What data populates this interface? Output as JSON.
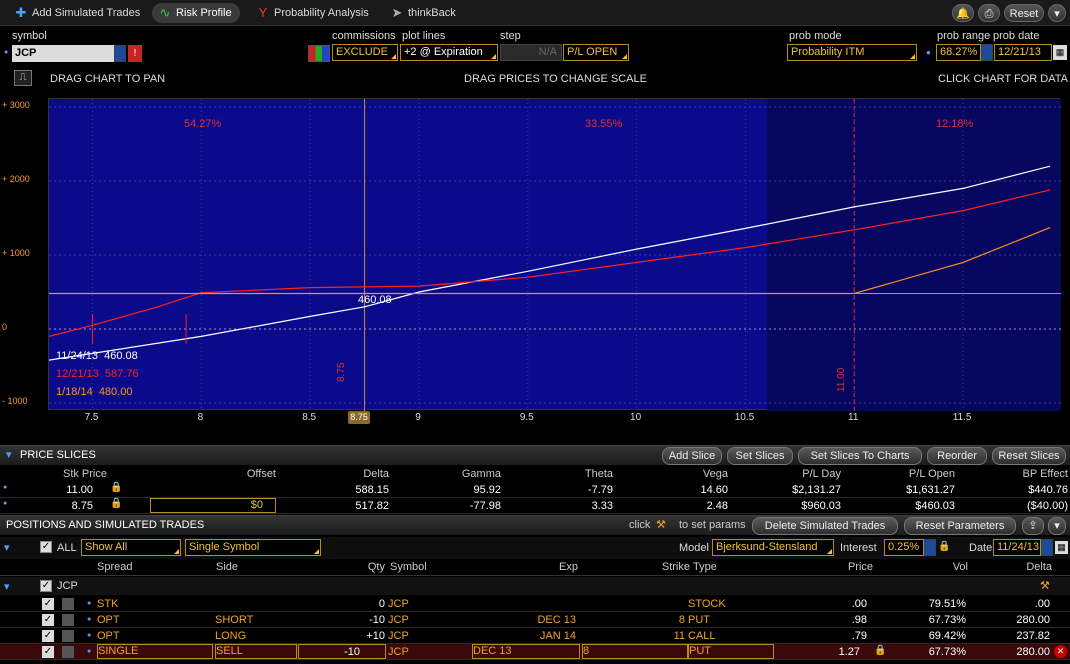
{
  "toolbar": {
    "tabs": [
      {
        "label": "Add Simulated Trades",
        "icon": "plus-icon"
      },
      {
        "label": "Risk Profile",
        "icon": "risk-profile-icon"
      },
      {
        "label": "Probability Analysis",
        "icon": "probability-icon"
      },
      {
        "label": "thinkBack",
        "icon": "thinkback-icon"
      }
    ],
    "reset_label": "Reset"
  },
  "controls": {
    "symbol_label": "symbol",
    "symbol_value": "JCP",
    "commissions_label": "commissions",
    "commissions_value": "EXCLUDE",
    "plot_lines_label": "plot lines",
    "plot_lines_value": "+2 @ Expiration",
    "step_label": "step",
    "step_value": "N/A",
    "pl_value": "P/L OPEN",
    "prob_mode_label": "prob mode",
    "prob_mode_value": "Probability ITM",
    "prob_range_label": "prob range",
    "prob_range_value": "68.27%",
    "prob_date_label": "prob date",
    "prob_date_value": "12/21/13"
  },
  "hints": {
    "pan": "DRAG CHART TO PAN",
    "scale": "DRAG PRICES TO CHANGE SCALE",
    "data": "CLICK CHART FOR DATA"
  },
  "chart_data": {
    "type": "line",
    "x_range": [
      7.3,
      11.95
    ],
    "y_range": [
      -1000,
      3000
    ],
    "x_ticks": [
      "7.5",
      "8",
      "8.5",
      "9",
      "9.5",
      "10",
      "10.5",
      "11",
      "11.5"
    ],
    "y_ticks": [
      "+ 3000",
      "+ 2000",
      "+ 1000",
      "0",
      "- 1000"
    ],
    "current_price": 8.75,
    "current_price_label": "8.75",
    "strike_line": 11.0,
    "strike_line_label": "11.00",
    "cursor_value_label": "460.08",
    "range_pcts": [
      "54.27%",
      "33.55%",
      "12.18%"
    ],
    "prob_band": [
      7.3,
      10.6
    ],
    "series": [
      {
        "name": "11/24/13",
        "value_label": "460.08",
        "color": "#ffffff",
        "points": [
          [
            7.3,
            -420
          ],
          [
            7.5,
            -330
          ],
          [
            8,
            -100
          ],
          [
            8.5,
            170
          ],
          [
            8.75,
            300
          ],
          [
            9,
            500
          ],
          [
            9.5,
            780
          ],
          [
            10,
            1080
          ],
          [
            10.5,
            1360
          ],
          [
            11,
            1650
          ],
          [
            11.5,
            1900
          ],
          [
            11.9,
            2200
          ]
        ]
      },
      {
        "name": "12/21/13",
        "value_label": "587.76",
        "color": "#ff2020",
        "points": [
          [
            7.3,
            -100
          ],
          [
            7.5,
            50
          ],
          [
            7.8,
            300
          ],
          [
            8,
            490
          ],
          [
            8.5,
            560
          ],
          [
            9,
            580
          ],
          [
            9.5,
            700
          ],
          [
            10,
            900
          ],
          [
            10.5,
            1100
          ],
          [
            11,
            1340
          ],
          [
            11.5,
            1600
          ],
          [
            11.9,
            1880
          ]
        ]
      },
      {
        "name": "1/18/14",
        "value_label": "480.00",
        "color": "#ff9020",
        "points": [
          [
            7.3,
            480
          ],
          [
            8,
            480
          ],
          [
            9,
            480
          ],
          [
            10,
            480
          ],
          [
            11,
            480
          ],
          [
            11.5,
            900
          ],
          [
            11.9,
            1370
          ]
        ]
      }
    ]
  },
  "price_slices": {
    "title": "PRICE SLICES",
    "buttons": [
      "Add Slice",
      "Set Slices",
      "Set Slices To Charts",
      "Reorder",
      "Reset Slices"
    ],
    "headers": [
      "Stk Price",
      "Offset",
      "Delta",
      "Gamma",
      "Theta",
      "Vega",
      "P/L Day",
      "P/L Open",
      "BP Effect"
    ],
    "rows": [
      [
        "11.00",
        "",
        "588.15",
        "95.92",
        "-7.79",
        "14.60",
        "$2,131.27",
        "$1,631.27",
        "$440.76"
      ],
      [
        "8.75",
        "$0",
        "517.82",
        "-77.98",
        "3.33",
        "2.48",
        "$960.03",
        "$460.03",
        "($40.00)"
      ]
    ]
  },
  "positions": {
    "title": "POSITIONS AND SIMULATED TRADES",
    "click_hint": "click",
    "params_hint": "to set params",
    "delete_label": "Delete Simulated Trades",
    "reset_params_label": "Reset Parameters",
    "all_label": "ALL",
    "show_value": "Show All",
    "symbol_filter": "Single Symbol",
    "model_label": "Model",
    "model_value": "Bjerksund-Stensland",
    "interest_label": "Interest",
    "interest_value": "0.25%",
    "date_label": "Date",
    "date_value": "11/24/13",
    "headers": [
      "Spread",
      "Side",
      "Qty",
      "Symbol",
      "Exp",
      "Strike",
      "Type",
      "Price",
      "Vol",
      "Delta"
    ],
    "group_label": "JCP",
    "rows": [
      {
        "spread": "STK",
        "side": "",
        "qty": "0",
        "symbol": "JCP",
        "exp": "",
        "strike": "",
        "type": "STOCK",
        "price": ".00",
        "vol": "79.51%",
        "delta": ".00"
      },
      {
        "spread": "OPT",
        "side": "SHORT",
        "qty": "-10",
        "symbol": "JCP",
        "exp": "DEC 13",
        "strike": "8",
        "type": "PUT",
        "price": ".98",
        "vol": "67.73%",
        "delta": "280.00"
      },
      {
        "spread": "OPT",
        "side": "LONG",
        "qty": "+10",
        "symbol": "JCP",
        "exp": "JAN 14",
        "strike": "11",
        "type": "CALL",
        "price": ".79",
        "vol": "69.42%",
        "delta": "237.82"
      },
      {
        "spread": "SINGLE",
        "side": "SELL",
        "qty": "-10",
        "symbol": "JCP",
        "exp": "DEC 13",
        "strike": "8",
        "type": "PUT",
        "price": "1.27",
        "vol": "67.73%",
        "delta": "280.00"
      }
    ]
  }
}
